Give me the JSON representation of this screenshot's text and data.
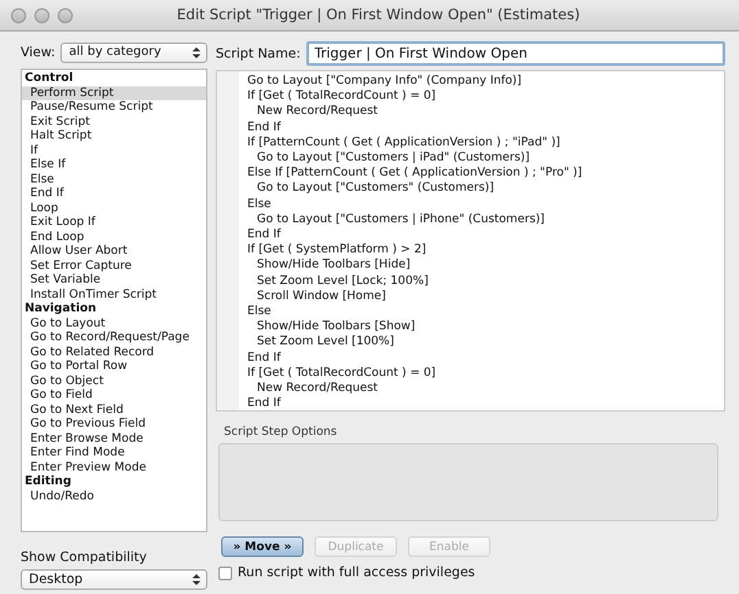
{
  "window": {
    "title": "Edit Script \"Trigger | On First Window Open\" (Estimates)"
  },
  "view": {
    "label": "View:",
    "value": "all by category"
  },
  "steps_list": [
    {
      "label": "Control",
      "items": [
        {
          "label": "Perform Script",
          "selected": true
        },
        {
          "label": "Pause/Resume Script",
          "selected": false
        },
        {
          "label": "Exit Script",
          "selected": false
        },
        {
          "label": "Halt Script",
          "selected": false
        },
        {
          "label": "If",
          "selected": false
        },
        {
          "label": "Else If",
          "selected": false
        },
        {
          "label": "Else",
          "selected": false
        },
        {
          "label": "End If",
          "selected": false
        },
        {
          "label": "Loop",
          "selected": false
        },
        {
          "label": "Exit Loop If",
          "selected": false
        },
        {
          "label": "End Loop",
          "selected": false
        },
        {
          "label": "Allow User Abort",
          "selected": false
        },
        {
          "label": "Set Error Capture",
          "selected": false
        },
        {
          "label": "Set Variable",
          "selected": false
        },
        {
          "label": "Install OnTimer Script",
          "selected": false
        }
      ]
    },
    {
      "label": "Navigation",
      "items": [
        {
          "label": "Go to Layout",
          "selected": false
        },
        {
          "label": "Go to Record/Request/Page",
          "selected": false
        },
        {
          "label": "Go to Related Record",
          "selected": false
        },
        {
          "label": "Go to Portal Row",
          "selected": false
        },
        {
          "label": "Go to Object",
          "selected": false
        },
        {
          "label": "Go to Field",
          "selected": false
        },
        {
          "label": "Go to Next Field",
          "selected": false
        },
        {
          "label": "Go to Previous Field",
          "selected": false
        },
        {
          "label": "Enter Browse Mode",
          "selected": false
        },
        {
          "label": "Enter Find Mode",
          "selected": false
        },
        {
          "label": "Enter Preview Mode",
          "selected": false
        }
      ]
    },
    {
      "label": "Editing",
      "items": [
        {
          "label": "Undo/Redo",
          "selected": false
        }
      ]
    }
  ],
  "compatibility": {
    "label": "Show Compatibility",
    "value": "Desktop"
  },
  "script_name": {
    "label": "Script Name:",
    "value": "Trigger | On First Window Open"
  },
  "script": [
    {
      "text": "Go to Layout [\"Company Info\" (Company Info)]"
    },
    {
      "text": "If [Get ( TotalRecordCount ) = 0]",
      "children": [
        {
          "text": "New Record/Request"
        }
      ]
    },
    {
      "text": "End If"
    },
    {
      "text": "If [PatternCount ( Get ( ApplicationVersion ) ; \"iPad\" )]",
      "children": [
        {
          "text": "Go to Layout [\"Customers | iPad\" (Customers)]"
        }
      ]
    },
    {
      "text": "Else If [PatternCount ( Get ( ApplicationVersion ) ; \"Pro\" )]",
      "children": [
        {
          "text": "Go to Layout [\"Customers\" (Customers)]"
        }
      ]
    },
    {
      "text": "Else",
      "children": [
        {
          "text": "Go to Layout [\"Customers | iPhone\" (Customers)]"
        }
      ]
    },
    {
      "text": "End If"
    },
    {
      "text": "If [Get ( SystemPlatform ) > 2]",
      "children": [
        {
          "text": "Show/Hide Toolbars [Hide]"
        },
        {
          "text": "Set Zoom Level [Lock; 100%]"
        },
        {
          "text": "Scroll Window [Home]"
        }
      ]
    },
    {
      "text": "Else",
      "children": [
        {
          "text": "Show/Hide Toolbars [Show]"
        },
        {
          "text": "Set Zoom Level [100%]"
        }
      ]
    },
    {
      "text": "End If"
    },
    {
      "text": "If [Get ( TotalRecordCount ) = 0]",
      "children": [
        {
          "text": "New Record/Request"
        }
      ]
    },
    {
      "text": "End If"
    }
  ],
  "options": {
    "label": "Script Step Options"
  },
  "buttons": [
    {
      "label": "» Move »",
      "kind": "default",
      "disabled": false
    },
    {
      "label": "Duplicate",
      "kind": "normal",
      "disabled": true
    },
    {
      "label": "Enable",
      "kind": "normal",
      "disabled": true
    }
  ],
  "full_access": {
    "label": "Run script with full access privileges",
    "checked": false
  }
}
